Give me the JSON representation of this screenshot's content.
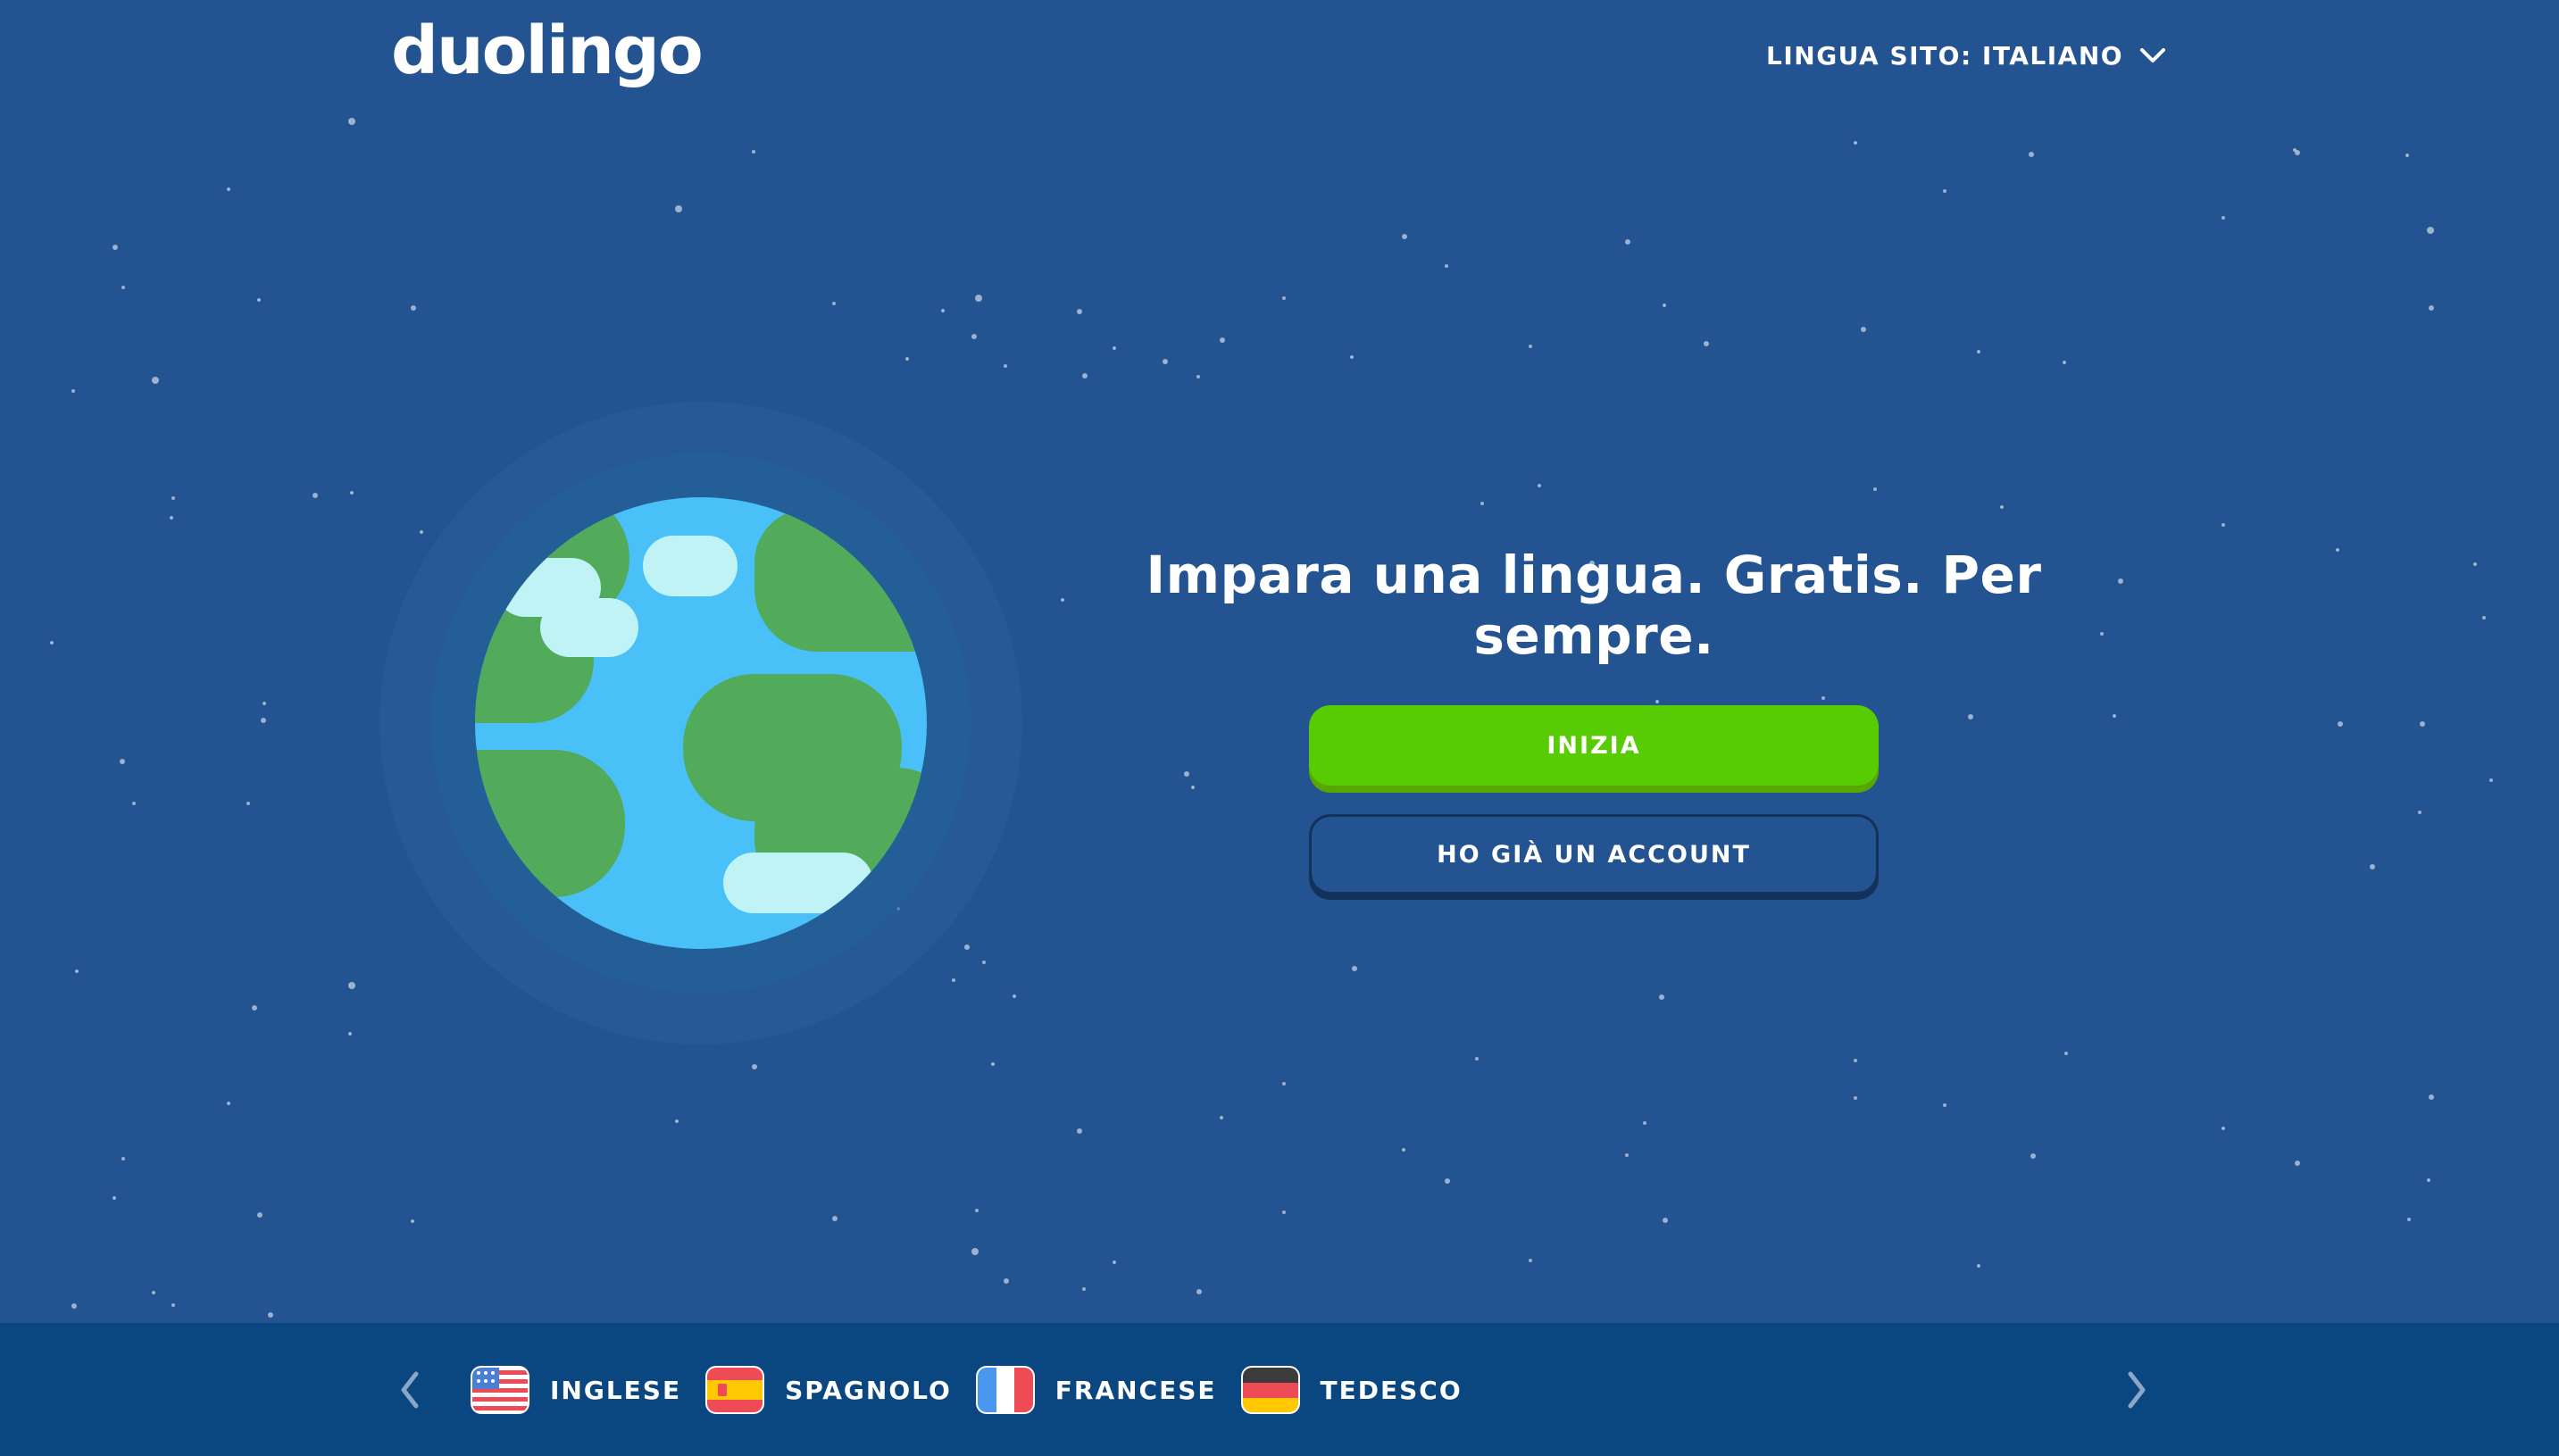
{
  "header": {
    "logo": "duolingo",
    "site_language_label": "LINGUA SITO: ITALIANO"
  },
  "hero": {
    "headline": "Impara una lingua. Gratis. Per sempre.",
    "start_button": "INIZIA",
    "login_button": "HO GIÀ UN ACCOUNT"
  },
  "footer": {
    "languages": [
      {
        "label": "INGLESE",
        "icon": "us-flag-icon"
      },
      {
        "label": "SPAGNOLO",
        "icon": "spain-flag-icon"
      },
      {
        "label": "FRANCESE",
        "icon": "france-flag-icon"
      },
      {
        "label": "TEDESCO",
        "icon": "germany-flag-icon"
      }
    ]
  },
  "colors": {
    "background": "#235390",
    "footer": "#0a4680",
    "primary_button": "#58cc02",
    "ocean": "#49c0f8",
    "land": "#52ab5a",
    "cloud": "#bff3f5"
  }
}
